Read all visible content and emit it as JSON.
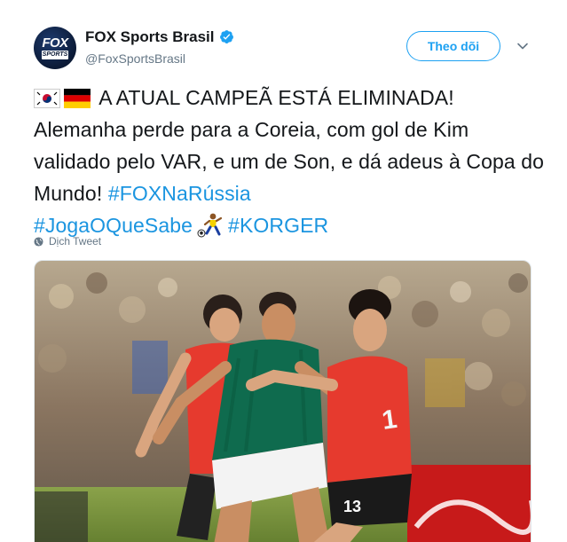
{
  "author": {
    "display_name": "FOX Sports Brasil",
    "handle": "@FoxSportsBrasil",
    "avatar_logo_top": "FOX",
    "avatar_logo_bottom": "SPORTS",
    "verified": true
  },
  "actions": {
    "follow_label": "Theo dõi",
    "caret_icon": "chevron-down-icon"
  },
  "tweet": {
    "flags": [
      "south-korea-flag",
      "germany-flag"
    ],
    "text_main": " A ATUAL CAMPEÃ ESTÁ ELIMINADA! Alemanha perde para a Coreia, com gol de Kim validado pelo VAR, e um de Son, e dá adeus à Copa do Mundo! ",
    "hashtag_1": "#FOXNaRússia",
    "hashtag_2": "#JogaOQueSabe",
    "emoji": "soccer-player-emoji",
    "hashtag_3": "#KORGER"
  },
  "translate": {
    "label": "Dịch Tweet",
    "icon": "globe-icon"
  },
  "media": {
    "description_icon": "match-photo",
    "player_number": "13"
  },
  "colors": {
    "accent": "#1da1f2",
    "link": "#1b95e0",
    "secondary_text": "#657786"
  }
}
